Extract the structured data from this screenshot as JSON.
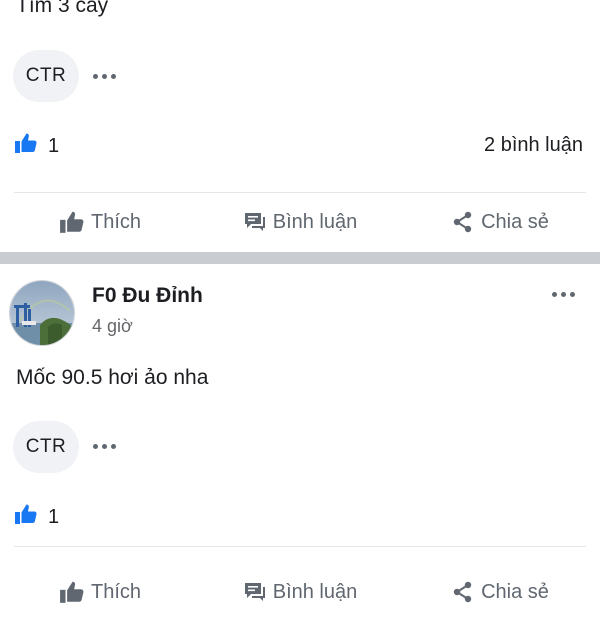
{
  "post1": {
    "text": "Tìm 3 cây",
    "chip_label": "CTR",
    "like_count": "1",
    "comment_count": "2 bình luận"
  },
  "post2": {
    "author": "F0 Đu Đỉnh",
    "time": "4 giờ",
    "text": "Mốc 90.5 hơi ảo nha",
    "chip_label": "CTR",
    "like_count": "1"
  },
  "actions": {
    "like": "Thích",
    "comment": "Bình luận",
    "share": "Chia sẻ"
  },
  "colors": {
    "like_blue": "#1877f2",
    "action_gray": "#606770",
    "separator": "#c9ccd1"
  }
}
